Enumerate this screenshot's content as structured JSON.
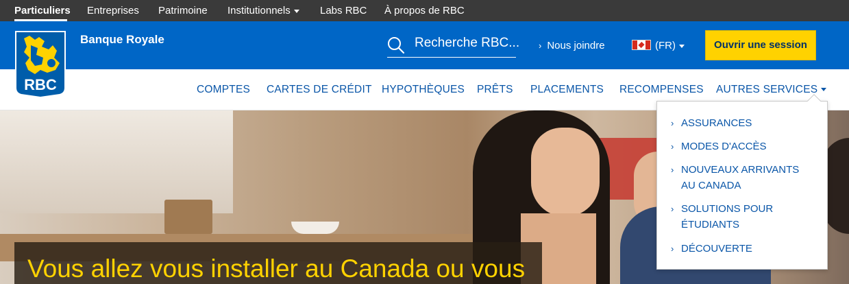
{
  "topbar": {
    "links": [
      {
        "label": "Particuliers",
        "active": true
      },
      {
        "label": "Entreprises"
      },
      {
        "label": "Patrimoine"
      },
      {
        "label": "Institutionnels",
        "has_caret": true
      },
      {
        "label": "Labs RBC"
      },
      {
        "label": "À propos de RBC"
      }
    ]
  },
  "header": {
    "bank_name": "Banque Royale",
    "logo_text": "RBC",
    "search_placeholder": "Recherche RBC...",
    "contact_label": "Nous joindre",
    "language_label": "(FR)",
    "login_label": "Ouvrir une session"
  },
  "nav": {
    "items": [
      {
        "label": "COMPTES"
      },
      {
        "label": "CARTES DE CRÉDIT"
      },
      {
        "label": "HYPOTHÈQUES"
      },
      {
        "label": "PRÊTS"
      },
      {
        "label": "PLACEMENTS"
      },
      {
        "label": "RECOMPENSES"
      },
      {
        "label": "AUTRES SERVICES",
        "has_caret": true,
        "expanded": true
      }
    ]
  },
  "dropdown": {
    "items": [
      {
        "label": "ASSURANCES"
      },
      {
        "label": "MODES D'ACCÈS"
      },
      {
        "label_line1": "NOUVEAUX ARRIVANTS",
        "label_line2": "AU CANADA"
      },
      {
        "label_line1": "SOLUTIONS POUR",
        "label_line2": "ÉTUDIANTS"
      },
      {
        "label": "DÉCOUVERTE"
      }
    ]
  },
  "hero": {
    "caption": "Vous allez vous installer au Canada ou vous"
  },
  "colors": {
    "topbar_bg": "#3a3a3a",
    "brand_blue": "#0066c6",
    "brand_yellow": "#ffd200",
    "link_blue": "#0a56a8",
    "navy": "#003168"
  },
  "icons": {
    "search": "search-icon",
    "contact_chevron": "chevron-right-icon",
    "flag": "canada-flag-icon",
    "dropdown_chevron": "chevron-right-icon"
  }
}
